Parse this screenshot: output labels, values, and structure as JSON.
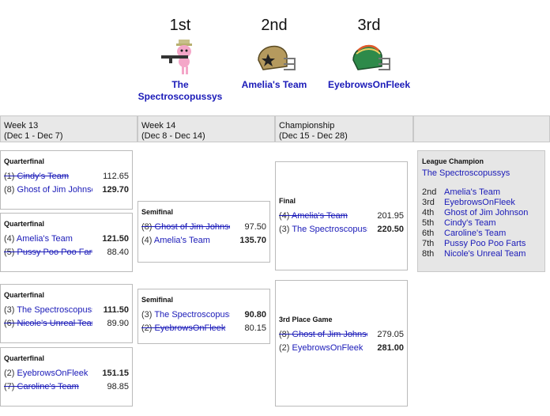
{
  "podium": [
    {
      "place": "1st",
      "team_line1": "The",
      "team_line2": "Spectroscopussys",
      "icon": "pink-character-with-gun-avatar"
    },
    {
      "place": "2nd",
      "team_line1": "Amelia's Team",
      "team_line2": "",
      "icon": "gold-football-helmet-avatar"
    },
    {
      "place": "3rd",
      "team_line1": "EyebrowsOnFleek",
      "team_line2": "",
      "icon": "green-football-helmet-avatar"
    }
  ],
  "weeks": [
    {
      "line1": "Week 13",
      "line2": "(Dec 1 - Dec 7)"
    },
    {
      "line1": "Week 14",
      "line2": "(Dec 8 - Dec 14)"
    },
    {
      "line1": "Championship",
      "line2": "(Dec 15 - Dec 28)"
    }
  ],
  "matchups": [
    {
      "title": "Quarterfinal",
      "teams": [
        {
          "seed": "(1)",
          "name": "Cindy's Team",
          "score": "112.65"
        },
        {
          "seed": "(8)",
          "name": "Ghost of Jim Johnson",
          "score": "129.70"
        }
      ]
    },
    {
      "title": "Quarterfinal",
      "teams": [
        {
          "seed": "(4)",
          "name": "Amelia's Team",
          "score": "121.50"
        },
        {
          "seed": "(5)",
          "name": "Pussy Poo Poo Farts",
          "score": "88.40"
        }
      ]
    },
    {
      "title": "Quarterfinal",
      "teams": [
        {
          "seed": "(3)",
          "name": "The Spectroscopussys",
          "score": "111.50"
        },
        {
          "seed": "(6)",
          "name": "Nicole's Unreal Team",
          "score": "89.90"
        }
      ]
    },
    {
      "title": "Quarterfinal",
      "teams": [
        {
          "seed": "(2)",
          "name": "EyebrowsOnFleek",
          "score": "151.15"
        },
        {
          "seed": "(7)",
          "name": "Caroline's Team",
          "score": "98.85"
        }
      ]
    },
    {
      "title": "Semifinal",
      "teams": [
        {
          "seed": "(8)",
          "name": "Ghost of Jim Johnson",
          "score": "97.50"
        },
        {
          "seed": "(4)",
          "name": "Amelia's Team",
          "score": "135.70"
        }
      ]
    },
    {
      "title": "Semifinal",
      "teams": [
        {
          "seed": "(3)",
          "name": "The Spectroscopussys",
          "score": "90.80"
        },
        {
          "seed": "(2)",
          "name": "EyebrowsOnFleek",
          "score": "80.15"
        }
      ]
    },
    {
      "title": "Final",
      "teams": [
        {
          "seed": "(4)",
          "name": "Amelia's Team",
          "score": "201.95"
        },
        {
          "seed": "(3)",
          "name": "The Spectroscopussys",
          "score": "220.50"
        }
      ]
    },
    {
      "title": "3rd Place Game",
      "teams": [
        {
          "seed": "(8)",
          "name": "Ghost of Jim Johnson",
          "score": "279.05"
        },
        {
          "seed": "(2)",
          "name": "EyebrowsOnFleek",
          "score": "281.00"
        }
      ]
    }
  ],
  "champion": {
    "heading": "League Champion",
    "name": "The Spectroscopussys",
    "standings": [
      {
        "place": "2nd",
        "team": "Amelia's Team"
      },
      {
        "place": "3rd",
        "team": "EyebrowsOnFleek"
      },
      {
        "place": "4th",
        "team": "Ghost of Jim Johnson"
      },
      {
        "place": "5th",
        "team": "Cindy's Team"
      },
      {
        "place": "6th",
        "team": "Caroline's Team"
      },
      {
        "place": "7th",
        "team": "Pussy Poo Poo Farts"
      },
      {
        "place": "8th",
        "team": "Nicole's Unreal Team"
      }
    ]
  }
}
